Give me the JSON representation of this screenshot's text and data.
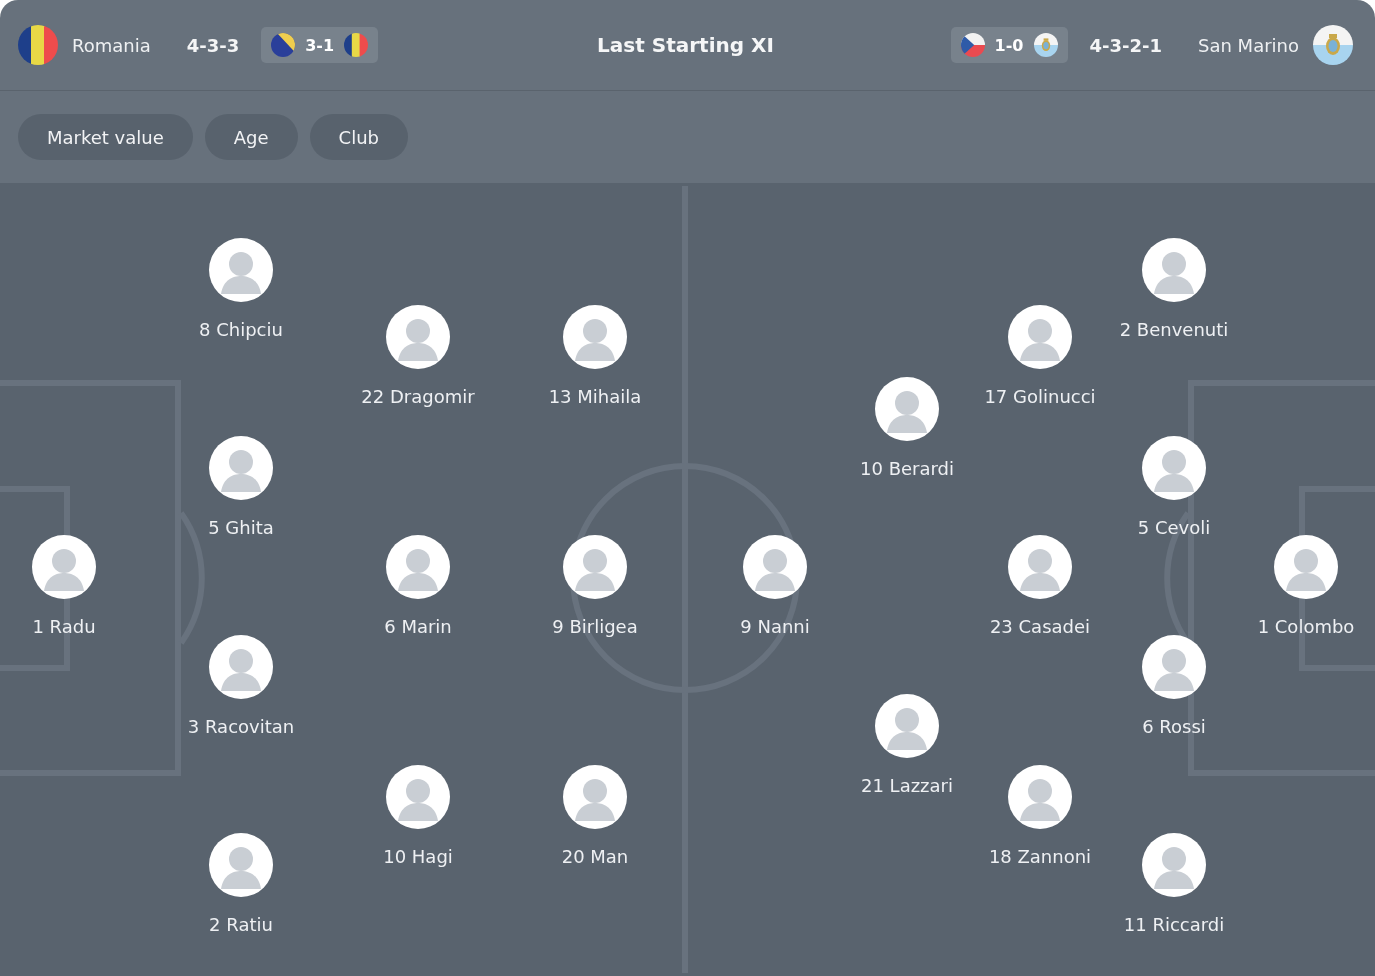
{
  "header": {
    "home": {
      "name": "Romania",
      "formation": "4-3-3",
      "last_match": {
        "score": "3-1"
      }
    },
    "title": "Last Starting XI",
    "away": {
      "name": "San Marino",
      "formation": "4-3-2-1",
      "last_match": {
        "score": "1-0"
      }
    }
  },
  "filters": [
    {
      "label": "Market value"
    },
    {
      "label": "Age"
    },
    {
      "label": "Club"
    }
  ],
  "teams": [
    {
      "kind": "home",
      "lines": [
        [
          {
            "label": "1 Radu"
          }
        ],
        [
          {
            "label": "8 Chipciu"
          },
          {
            "label": "5 Ghita"
          },
          {
            "label": "3 Racovitan"
          },
          {
            "label": "2 Ratiu"
          }
        ],
        [
          {
            "label": "22 Dragomir"
          },
          {
            "label": "6 Marin"
          },
          {
            "label": "10 Hagi"
          }
        ],
        [
          {
            "label": "13 Mihaila"
          },
          {
            "label": "9 Birligea"
          },
          {
            "label": "20 Man"
          }
        ]
      ]
    },
    {
      "kind": "away",
      "lines": [
        [
          {
            "label": "9 Nanni"
          }
        ],
        [
          {
            "label": "10 Berardi"
          },
          {
            "label": "21 Lazzari"
          }
        ],
        [
          {
            "label": "17 Golinucci"
          },
          {
            "label": "23 Casadei"
          },
          {
            "label": "18 Zannoni"
          }
        ],
        [
          {
            "label": "2 Benvenuti"
          },
          {
            "label": "5 Cevoli"
          },
          {
            "label": "6 Rossi"
          },
          {
            "label": "11 Riccardi"
          }
        ],
        [
          {
            "label": "1 Colombo"
          }
        ]
      ]
    }
  ]
}
